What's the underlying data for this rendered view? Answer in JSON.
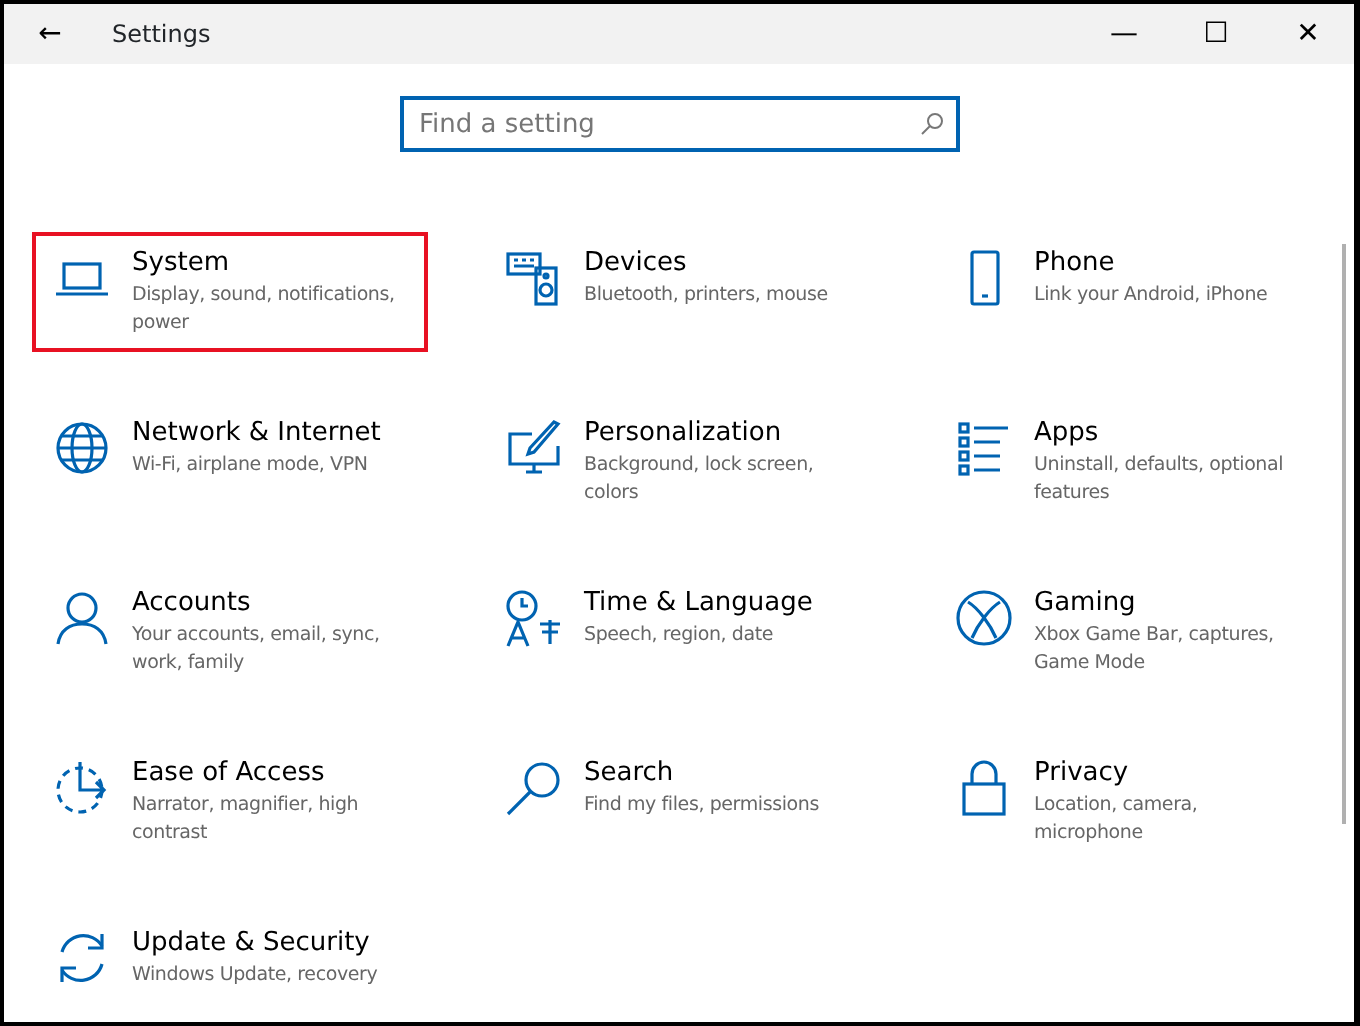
{
  "window": {
    "title": "Settings",
    "back": "←",
    "controls": [
      "—",
      "☐",
      "✕"
    ]
  },
  "search": {
    "placeholder": "Find a setting"
  },
  "tiles": [
    {
      "title": "System",
      "description": "Display, sound, notifications, power",
      "highlighted": true
    },
    {
      "title": "Devices",
      "description": "Bluetooth, printers, mouse",
      "highlighted": false
    },
    {
      "title": "Phone",
      "description": "Link your Android, iPhone",
      "highlighted": false
    },
    {
      "title": "Network & Internet",
      "description": "Wi-Fi, airplane mode, VPN",
      "highlighted": false
    },
    {
      "title": "Personalization",
      "description": "Background, lock screen, colors",
      "highlighted": false
    },
    {
      "title": "Apps",
      "description": "Uninstall, defaults, optional features",
      "highlighted": false
    },
    {
      "title": "Accounts",
      "description": "Your accounts, email, sync, work, family",
      "highlighted": false
    },
    {
      "title": "Time & Language",
      "description": "Speech, region, date",
      "highlighted": false
    },
    {
      "title": "Gaming",
      "description": "Xbox Game Bar, captures, Game Mode",
      "highlighted": false
    },
    {
      "title": "Ease of Access",
      "description": "Narrator, magnifier, high contrast",
      "highlighted": false
    },
    {
      "title": "Search",
      "description": "Find my files, permissions",
      "highlighted": false
    },
    {
      "title": "Privacy",
      "description": "Location, camera, microphone",
      "highlighted": false
    },
    {
      "title": "Update & Security",
      "description": "Windows Update, recovery",
      "highlighted": false
    }
  ]
}
